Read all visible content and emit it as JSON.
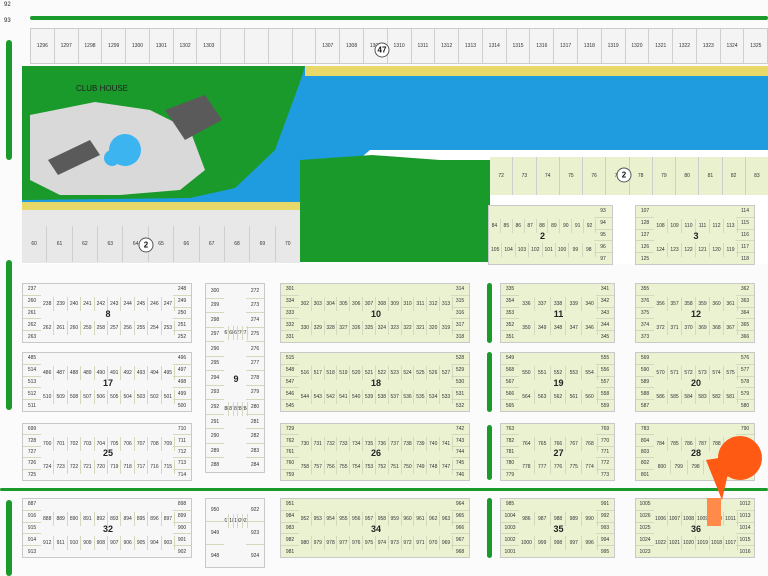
{
  "map": {
    "clubhouse_label": "CLUB HOUSE",
    "colors": {
      "green": "#1a9a2a",
      "water": "#1f9be0",
      "lawn": "#e9f1cf",
      "sand": "#e8d86a",
      "road": "#fbfbfb",
      "marker": "#ff5a14"
    },
    "top_left_numbers": [
      "92",
      "93"
    ],
    "top_row_lots": [
      "1296",
      "1297",
      "1298",
      "1299",
      "1300",
      "1301",
      "1302",
      "1303",
      "",
      "",
      "",
      "",
      "1307",
      "1308",
      "1309",
      "1310",
      "1311",
      "1312",
      "1313",
      "1314",
      "1315",
      "1316",
      "1317",
      "1318",
      "1319",
      "1320",
      "1321",
      "1322",
      "1323",
      "1324",
      "1325"
    ],
    "block_47": "47",
    "east_canal_lots": [
      "72",
      "73",
      "74",
      "75",
      "76",
      "77",
      "78",
      "79",
      "80",
      "81",
      "82",
      "83"
    ],
    "west_canal_lots": [
      "60",
      "61",
      "62",
      "63",
      "64",
      "65",
      "66",
      "67",
      "68",
      "69",
      "70"
    ],
    "canal_block_label": "2",
    "block_2": {
      "label": "2",
      "top": [
        "84",
        "85",
        "86",
        "87",
        "88",
        "89",
        "90",
        "91",
        "92"
      ],
      "bottom": [
        "105",
        "104",
        "103",
        "102",
        "101",
        "100",
        "99",
        "98"
      ],
      "right": [
        "93",
        "94",
        "95",
        "96",
        "97"
      ]
    },
    "block_3": {
      "label": "3",
      "left": [
        "107",
        "128",
        "127",
        "126",
        "125"
      ],
      "top": [
        "108",
        "109",
        "110",
        "111",
        "112",
        "113"
      ],
      "bottom": [
        "124",
        "123",
        "122",
        "121",
        "120",
        "119"
      ],
      "right": [
        "114",
        "115",
        "116",
        "117",
        "118"
      ]
    },
    "block_8": {
      "label": "8",
      "left": [
        "237",
        "260",
        "261",
        "262",
        "263"
      ],
      "top": [
        "238",
        "239",
        "240",
        "241",
        "242",
        "243",
        "244",
        "245",
        "246",
        "247"
      ],
      "bottom": [
        "262",
        "261",
        "260",
        "259",
        "258",
        "257",
        "256",
        "255",
        "254",
        "253"
      ],
      "right": [
        "248",
        "249",
        "250",
        "251",
        "252"
      ]
    },
    "block_9": {
      "label": "9",
      "top": [
        "267",
        "268",
        "269",
        "270",
        "271"
      ],
      "left": [
        "300",
        "299",
        "298",
        "297",
        "296",
        "295",
        "294",
        "293",
        "292",
        "291",
        "290",
        "289",
        "288"
      ],
      "right": [
        "272",
        "273",
        "274",
        "275",
        "276",
        "277",
        "278",
        "279",
        "280",
        "281",
        "282",
        "283",
        "284"
      ],
      "bottom": [
        "288",
        "287",
        "286",
        "285",
        "284"
      ]
    },
    "block_10": {
      "label": "10",
      "left": [
        "301",
        "334",
        "333",
        "332",
        "331"
      ],
      "top": [
        "302",
        "303",
        "304",
        "305",
        "306",
        "307",
        "308",
        "309",
        "310",
        "311",
        "312",
        "313"
      ],
      "bottom": [
        "330",
        "329",
        "328",
        "327",
        "326",
        "325",
        "324",
        "323",
        "322",
        "321",
        "320",
        "319"
      ],
      "right": [
        "314",
        "315",
        "316",
        "317",
        "318"
      ]
    },
    "block_11": {
      "label": "11",
      "left": [
        "335",
        "354",
        "353",
        "352",
        "351"
      ],
      "top": [
        "336",
        "337",
        "338",
        "339",
        "340"
      ],
      "bottom": [
        "350",
        "349",
        "348",
        "347",
        "346"
      ],
      "right": [
        "341",
        "342",
        "343",
        "344",
        "345"
      ]
    },
    "block_12": {
      "label": "12",
      "left": [
        "355",
        "376",
        "375",
        "374",
        "373"
      ],
      "top": [
        "356",
        "357",
        "358",
        "359",
        "360",
        "361"
      ],
      "bottom": [
        "372",
        "371",
        "370",
        "369",
        "368",
        "367"
      ],
      "right": [
        "362",
        "363",
        "364",
        "365",
        "366"
      ]
    },
    "block_17": {
      "label": "17",
      "left": [
        "485",
        "514",
        "513",
        "512",
        "511"
      ],
      "top": [
        "486",
        "487",
        "488",
        "489",
        "490",
        "491",
        "492",
        "493",
        "494",
        "495"
      ],
      "bottom": [
        "510",
        "509",
        "508",
        "507",
        "506",
        "505",
        "504",
        "503",
        "502",
        "501"
      ],
      "right": [
        "496",
        "497",
        "498",
        "499",
        "500"
      ]
    },
    "block_18": {
      "label": "18",
      "left": [
        "515",
        "548",
        "547",
        "546",
        "545"
      ],
      "top": [
        "516",
        "517",
        "518",
        "519",
        "520",
        "521",
        "522",
        "523",
        "524",
        "525",
        "526",
        "527"
      ],
      "bottom": [
        "544",
        "543",
        "542",
        "541",
        "540",
        "539",
        "538",
        "537",
        "536",
        "535",
        "534",
        "533"
      ],
      "right": [
        "528",
        "529",
        "530",
        "531",
        "532"
      ]
    },
    "block_19": {
      "label": "19",
      "left": [
        "549",
        "568",
        "567",
        "566",
        "565"
      ],
      "top": [
        "550",
        "551",
        "552",
        "553",
        "554"
      ],
      "bottom": [
        "564",
        "563",
        "562",
        "561",
        "560"
      ],
      "right": [
        "555",
        "556",
        "557",
        "558",
        "559"
      ]
    },
    "block_20": {
      "label": "20",
      "left": [
        "569",
        "590",
        "589",
        "588",
        "587"
      ],
      "top": [
        "570",
        "571",
        "572",
        "573",
        "574",
        "575"
      ],
      "bottom": [
        "586",
        "585",
        "584",
        "583",
        "582",
        "581"
      ],
      "right": [
        "576",
        "577",
        "578",
        "579",
        "580"
      ]
    },
    "block_25": {
      "label": "25",
      "left": [
        "699",
        "728",
        "727",
        "726",
        "725"
      ],
      "top": [
        "700",
        "701",
        "702",
        "703",
        "704",
        "705",
        "706",
        "707",
        "708",
        "709"
      ],
      "bottom": [
        "724",
        "723",
        "722",
        "721",
        "720",
        "719",
        "718",
        "717",
        "716",
        "715"
      ],
      "right": [
        "710",
        "711",
        "712",
        "713",
        "714"
      ]
    },
    "block_26": {
      "label": "26",
      "left": [
        "729",
        "762",
        "761",
        "760",
        "759"
      ],
      "top": [
        "730",
        "731",
        "732",
        "733",
        "734",
        "735",
        "736",
        "737",
        "738",
        "739",
        "740",
        "741"
      ],
      "bottom": [
        "758",
        "757",
        "756",
        "755",
        "754",
        "753",
        "752",
        "751",
        "750",
        "749",
        "748",
        "747"
      ],
      "right": [
        "742",
        "743",
        "744",
        "745",
        "746"
      ]
    },
    "block_27": {
      "label": "27",
      "left": [
        "763",
        "782",
        "781",
        "780",
        "779"
      ],
      "top": [
        "764",
        "765",
        "766",
        "767",
        "768"
      ],
      "bottom": [
        "778",
        "777",
        "776",
        "775",
        "774"
      ],
      "right": [
        "769",
        "770",
        "771",
        "772",
        "773"
      ]
    },
    "block_28": {
      "label": "28",
      "left": [
        "783",
        "804",
        "803",
        "802",
        "801"
      ],
      "top": [
        "784",
        "785",
        "786",
        "787",
        "788",
        "789"
      ],
      "bottom": [
        "800",
        "799",
        "798",
        "797",
        "796"
      ],
      "right": [
        "790",
        "791",
        "792",
        "793",
        "794"
      ]
    },
    "block_32": {
      "label": "32",
      "left": [
        "887",
        "916",
        "915",
        "914",
        "913"
      ],
      "top": [
        "888",
        "889",
        "890",
        "891",
        "892",
        "893",
        "894",
        "895",
        "896",
        "897"
      ],
      "bottom": [
        "912",
        "911",
        "910",
        "909",
        "908",
        "907",
        "906",
        "905",
        "904",
        "903"
      ],
      "right": [
        "898",
        "899",
        "900",
        "901",
        "902"
      ]
    },
    "block_33": {
      "top": [
        "917",
        "918",
        "919",
        "920",
        "921"
      ],
      "left": [
        "950",
        "949",
        "948"
      ],
      "right": [
        "922",
        "923",
        "924"
      ]
    },
    "block_34": {
      "label": "34",
      "left": [
        "951",
        "984",
        "983",
        "982",
        "981"
      ],
      "top": [
        "952",
        "953",
        "954",
        "955",
        "956",
        "957",
        "958",
        "959",
        "960",
        "961",
        "962",
        "963"
      ],
      "bottom": [
        "980",
        "979",
        "978",
        "977",
        "976",
        "975",
        "974",
        "973",
        "972",
        "971",
        "970",
        "969"
      ],
      "right": [
        "964",
        "965",
        "966",
        "967",
        "968"
      ]
    },
    "block_35": {
      "label": "35",
      "left": [
        "985",
        "1004",
        "1003",
        "1002",
        "1001"
      ],
      "top": [
        "986",
        "987",
        "988",
        "989",
        "990"
      ],
      "bottom": [
        "1000",
        "999",
        "998",
        "997",
        "996"
      ],
      "right": [
        "991",
        "992",
        "993",
        "994",
        "995"
      ]
    },
    "block_36": {
      "label": "36",
      "left": [
        "1005",
        "1026",
        "1025",
        "1024",
        "1023"
      ],
      "top": [
        "1006",
        "1007",
        "1008",
        "1009",
        "1010",
        "1011"
      ],
      "bottom": [
        "1022",
        "1021",
        "1020",
        "1019",
        "1018",
        "1017"
      ],
      "right": [
        "1012",
        "1013",
        "1014",
        "1015",
        "1016"
      ]
    }
  }
}
